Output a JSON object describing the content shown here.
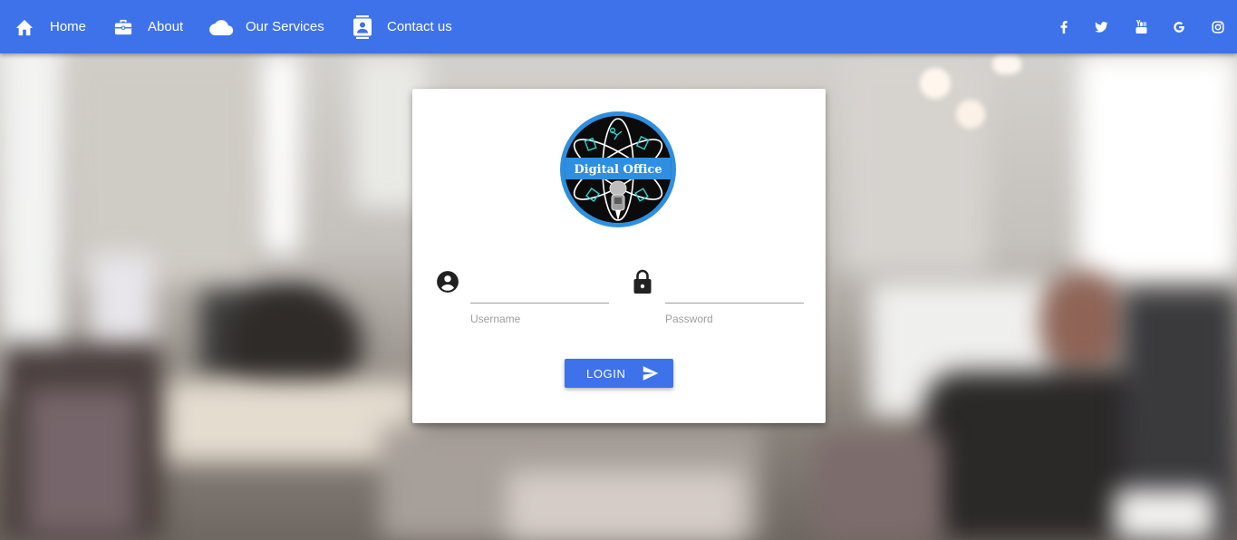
{
  "nav": {
    "items": [
      {
        "label": "Home",
        "icon": "home-icon"
      },
      {
        "label": "About",
        "icon": "briefcase-icon"
      },
      {
        "label": "Our Services",
        "icon": "cloud-icon"
      },
      {
        "label": "Contact us",
        "icon": "contact-card-icon"
      }
    ],
    "social": [
      "facebook-icon",
      "twitter-icon",
      "youtube-icon",
      "google-icon",
      "instagram-icon"
    ]
  },
  "login": {
    "logo_text": "Digital Office",
    "username": {
      "label": "Username",
      "value": "",
      "icon": "account-circle-icon"
    },
    "password": {
      "label": "Password",
      "value": "",
      "icon": "lock-icon"
    },
    "button_label": "LOGIN",
    "button_icon": "send-icon"
  },
  "colors": {
    "primary": "#3d72ea",
    "card": "#ffffff",
    "logo_ring": "#2e8fe0",
    "logo_accent": "#2ad4d4"
  }
}
